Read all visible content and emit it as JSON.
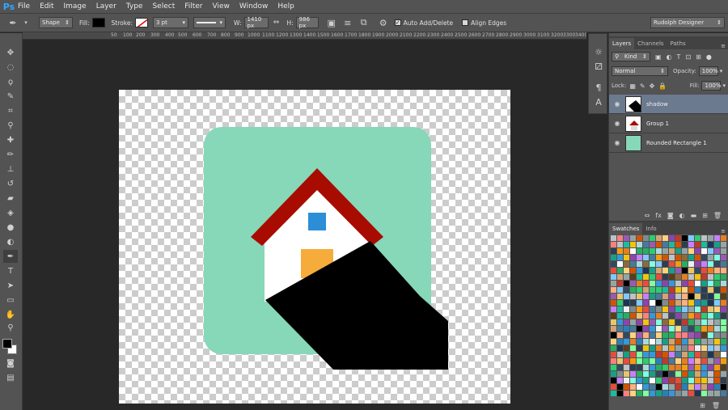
{
  "app": {
    "logo": "Ps"
  },
  "menu": [
    "File",
    "Edit",
    "Image",
    "Layer",
    "Type",
    "Select",
    "Filter",
    "View",
    "Window",
    "Help"
  ],
  "options": {
    "mode": "Shape",
    "fill_label": "Fill:",
    "stroke_label": "Stroke:",
    "stroke_width": "3 pt",
    "w_label": "W:",
    "w_value": "1410 px",
    "h_label": "H:",
    "h_value": "986 px",
    "auto_add_delete": "Auto Add/Delete",
    "align_edges": "Align Edges",
    "workspace": "Rudolph Designer"
  },
  "ruler": [
    "50",
    "100",
    "200",
    "300",
    "400",
    "500",
    "600",
    "700",
    "800",
    "900",
    "1000",
    "1100",
    "1200",
    "1300",
    "1400",
    "1500",
    "1600",
    "1700",
    "1800",
    "1900",
    "2000",
    "2100",
    "2200",
    "2300",
    "2400",
    "2500",
    "2600",
    "2700",
    "2800",
    "2900",
    "3000",
    "3100",
    "3200",
    "3300",
    "3400"
  ],
  "layers_panel": {
    "tabs": [
      "Layers",
      "Channels",
      "Paths"
    ],
    "filter": "Kind",
    "blend_mode": "Normal",
    "opacity_label": "Opacity:",
    "opacity": "100%",
    "lock_label": "Lock:",
    "fill_label": "Fill:",
    "fill": "100%",
    "layers": [
      {
        "name": "shadow",
        "selected": true
      },
      {
        "name": "Group 1",
        "selected": false
      },
      {
        "name": "Rounded Rectangle 1",
        "selected": false
      }
    ]
  },
  "swatches_panel": {
    "tabs": [
      "Swatches",
      "Info"
    ]
  },
  "colors": {
    "icon_bg": "#87d7b9",
    "roof": "#a80c00",
    "window": "#2b8ed7",
    "door": "#f6ac3a",
    "shadow": "#000000",
    "layer_selected": "#6b7a8f"
  }
}
